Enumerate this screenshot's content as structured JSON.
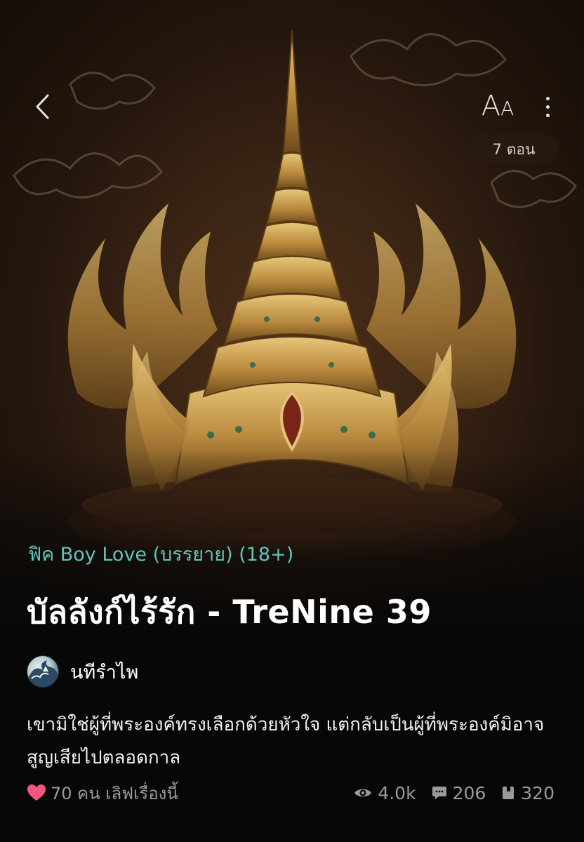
{
  "header": {
    "back_icon": "chevron-left-icon",
    "font_size_label_big": "A",
    "font_size_label_small": "A",
    "more_icon": "more-vertical-icon",
    "episode_count": "7 ตอน"
  },
  "story": {
    "category": "ฟิค Boy Love (บรรยาย) (18+)",
    "title": "บัลลังก์ไร้รัก - TreNine 39",
    "author": "นทีรำไพ",
    "synopsis": "เขามิใช่ผู้ที่พระองค์ทรงเลือกด้วยหัวใจ แต่กลับเป็นผู้ที่พระองค์มิอาจสูญเสียไปตลอดกาล",
    "likes_text": "70 คน เลิฟเรื่องนี้"
  },
  "stats": {
    "views": "4.0k",
    "comments": "206",
    "bookmarks": "320"
  },
  "colors": {
    "accent": "#5fc6b8",
    "heart": "#f0577d",
    "muted": "#9a9a9a",
    "gold": "#c9a256"
  }
}
